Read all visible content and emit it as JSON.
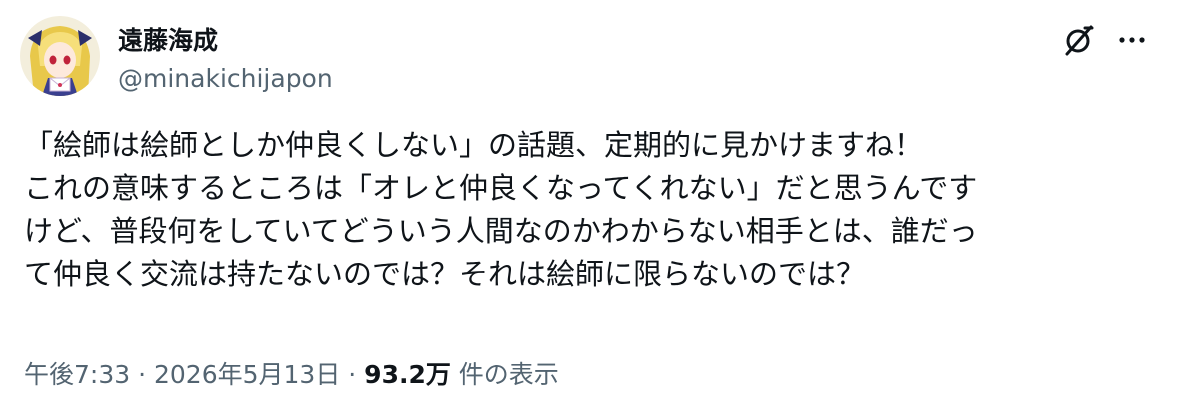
{
  "author": {
    "display_name": "遠藤海成",
    "handle": "@minakichijapon"
  },
  "icons": {
    "avatar": "avatar-image",
    "grok": "grok-icon",
    "more": "more-icon"
  },
  "tweet": {
    "lines": [
      "「絵師は絵師としか仲良くしない」の話題、定期的に見かけますね！",
      "これの意味するところは「オレと仲良くなってくれない」だと思うんです",
      "けど、普段何をしていてどういう人間なのかわからない相手とは、誰だっ",
      "て仲良く交流は持たないのでは？それは絵師に限らないのでは？"
    ]
  },
  "meta": {
    "time": "午後7:33",
    "separator1": " · ",
    "date": "2026年5月13日",
    "separator2": " · ",
    "views_count": "93.2万",
    "views_label": " 件の表示"
  },
  "colors": {
    "text_primary": "#0f1419",
    "text_secondary": "#536471",
    "background": "#ffffff"
  }
}
